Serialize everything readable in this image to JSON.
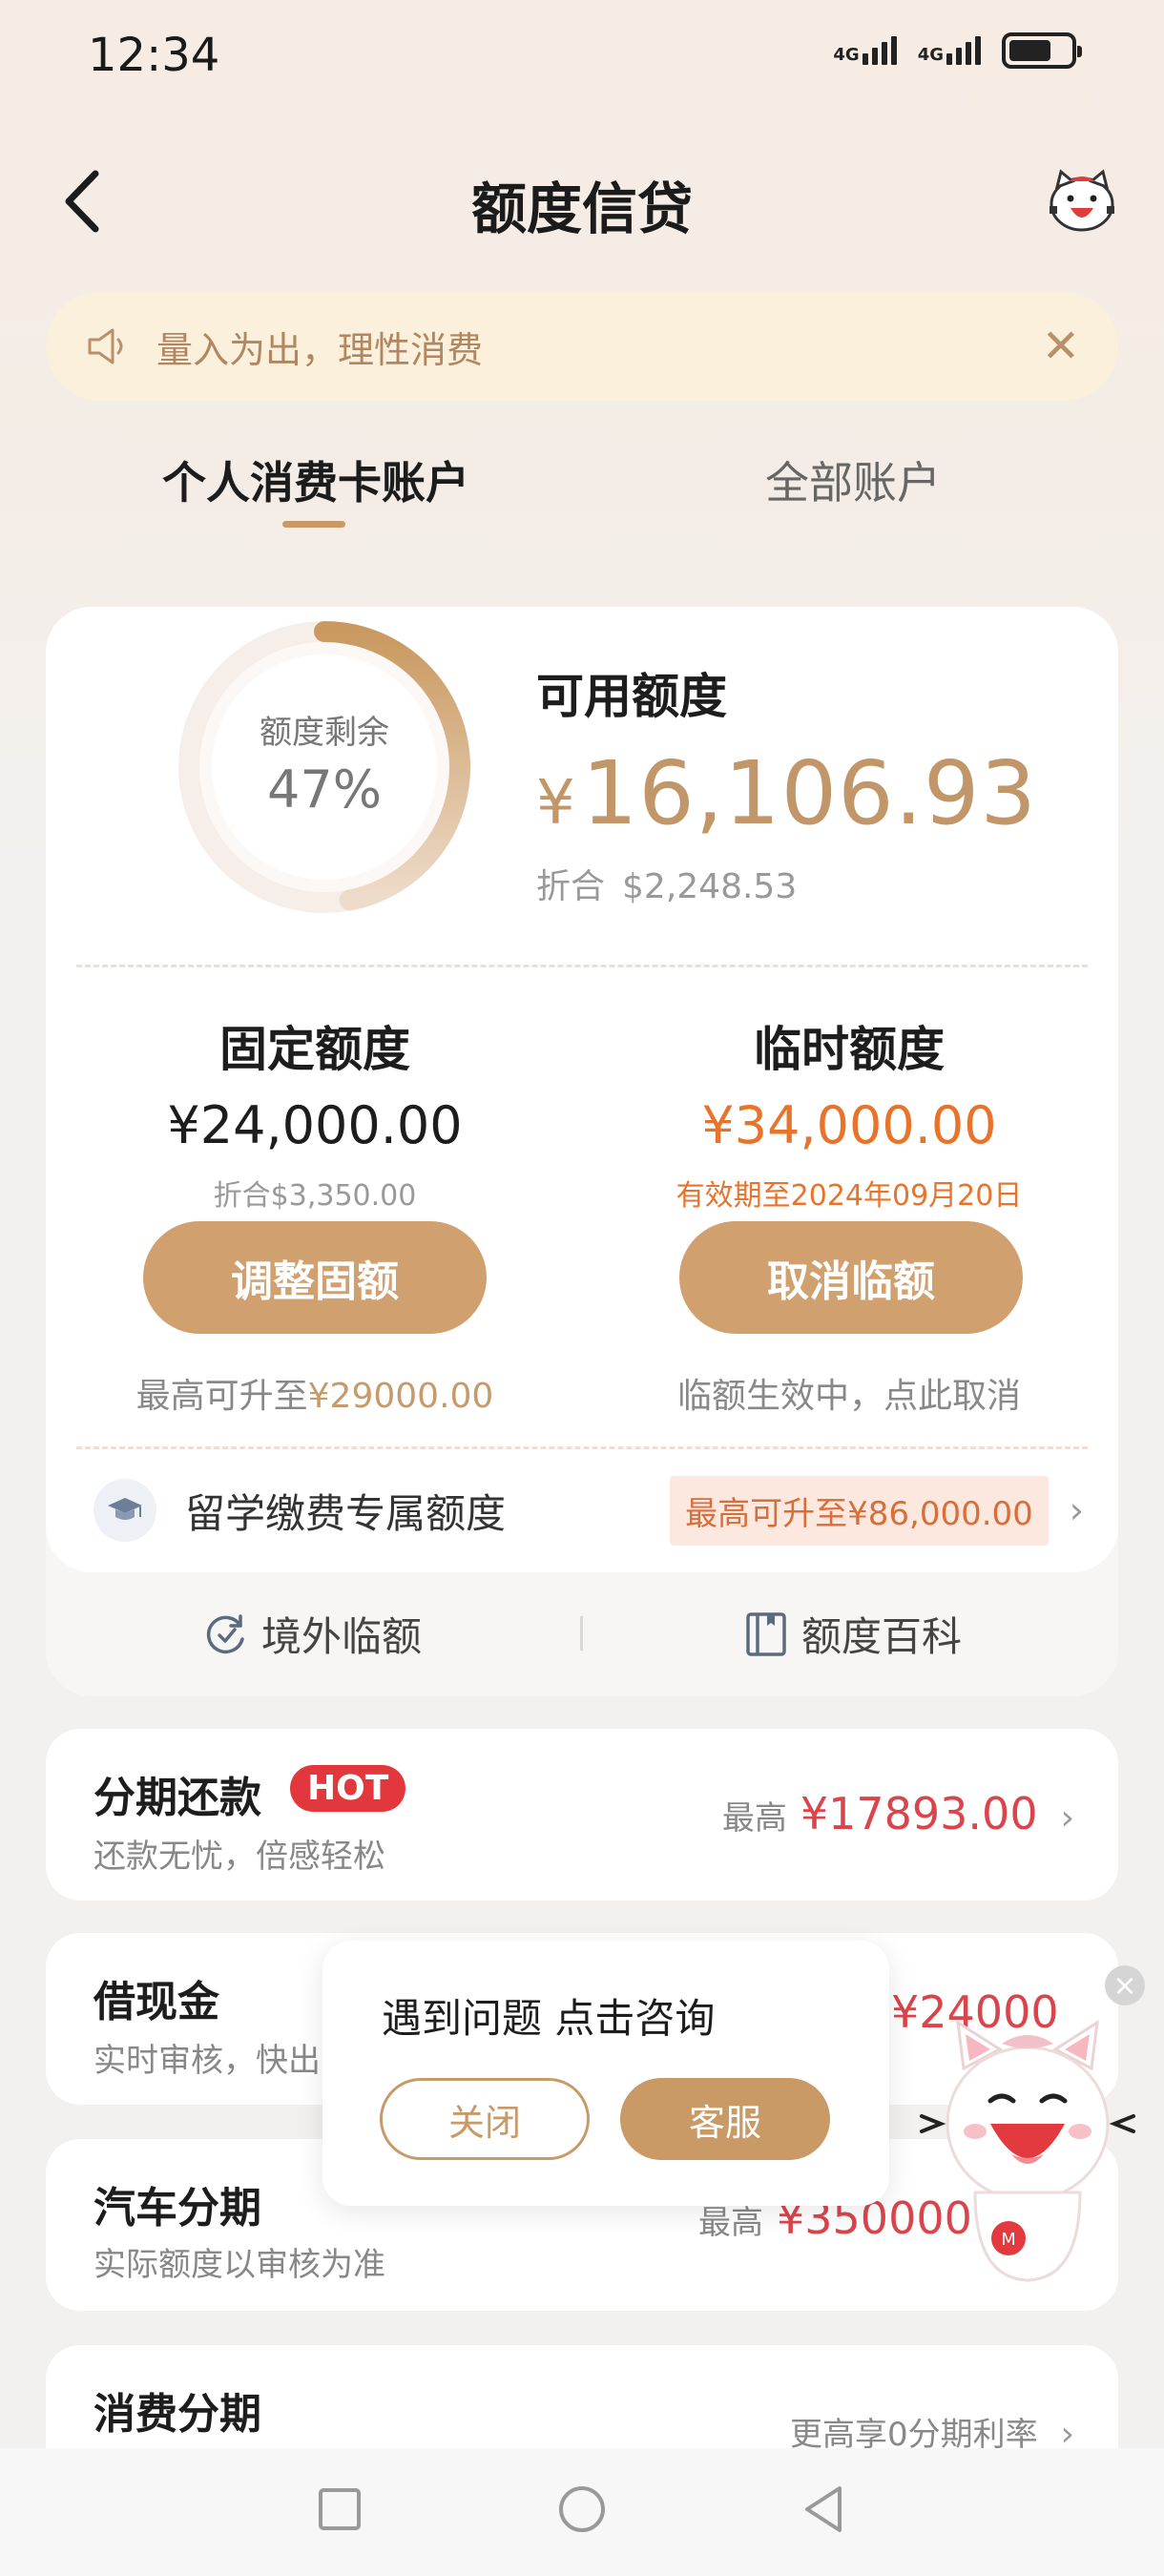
{
  "status": {
    "time": "12:34",
    "network1": "4G",
    "network2": "4G",
    "battery_level": 0.7
  },
  "header": {
    "title": "额度信贷"
  },
  "notice": {
    "text": "量入为出，理性消费"
  },
  "tabs": [
    {
      "label": "个人消费卡账户",
      "active": true
    },
    {
      "label": "全部账户",
      "active": false
    }
  ],
  "summary": {
    "ring_label": "额度剩余",
    "ring_percent_text": "47%",
    "ring_fraction": 0.47,
    "available_label": "可用额度",
    "currency": "¥",
    "available_amount": "16,106.93",
    "equiv_label": "折合",
    "equiv_amount": "$2,248.53"
  },
  "fixed": {
    "title": "固定额度",
    "amount": "¥24,000.00",
    "sub": "折合$3,350.00",
    "button": "调整固额",
    "hint_prefix": "最高可升至",
    "hint_value": "¥29000.00"
  },
  "temporary": {
    "title": "临时额度",
    "amount": "¥34,000.00",
    "sub": "有效期至2024年09月20日",
    "button": "取消临额",
    "hint": "临额生效中，点此取消"
  },
  "study": {
    "label": "留学缴费专属额度",
    "tag": "最高可升至¥86,000.00"
  },
  "quick_links": [
    {
      "label": "境外临额",
      "icon": "refresh-clock-icon"
    },
    {
      "label": "额度百科",
      "icon": "book-icon"
    }
  ],
  "products": [
    {
      "title": "分期还款",
      "badge": "HOT",
      "sub": "还款无忧，倍感轻松",
      "right_label": "最高",
      "right_amount": "¥17893.00"
    },
    {
      "title": "借现金",
      "sub": "实时审核，快出",
      "right_label": "",
      "right_amount": "¥24000"
    },
    {
      "title": "汽车分期",
      "sub": "实际额度以审核为准",
      "right_label": "最高",
      "right_amount": "¥350000"
    },
    {
      "title": "消费分期",
      "sub": "",
      "right_label": "更高享0分期利率",
      "right_amount": ""
    }
  ],
  "popup": {
    "text": "遇到问题 点击咨询",
    "close": "关闭",
    "service": "客服"
  },
  "colors": {
    "accent": "#c99a66",
    "red": "#d9454b",
    "orange": "#e8742c"
  }
}
